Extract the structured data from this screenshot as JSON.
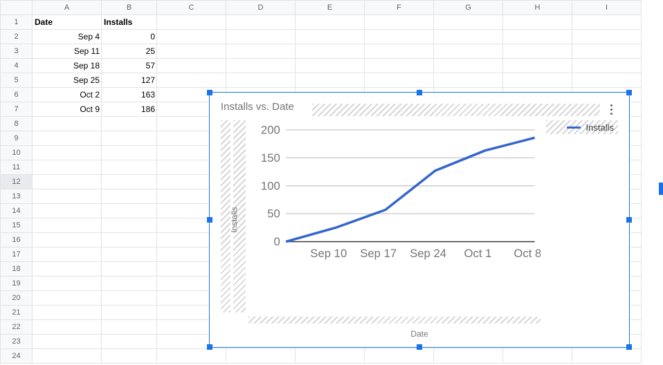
{
  "columns": [
    "A",
    "B",
    "C",
    "D",
    "E",
    "F",
    "G",
    "H",
    "I"
  ],
  "rows": 24,
  "header": {
    "A": "Date",
    "B": "Installs"
  },
  "data": [
    {
      "A": "Sep 4",
      "B": "0"
    },
    {
      "A": "Sep 11",
      "B": "25"
    },
    {
      "A": "Sep 18",
      "B": "57"
    },
    {
      "A": "Sep 25",
      "B": "127"
    },
    {
      "A": "Oct 2",
      "B": "163"
    },
    {
      "A": "Oct 9",
      "B": "186"
    }
  ],
  "selected_row": 12,
  "chart": {
    "title": "Installs vs. Date",
    "xlabel": "Date",
    "ylabel": "Installs",
    "legend": "Installs",
    "x_ticks": [
      "Sep 10",
      "Sep 17",
      "Sep 24",
      "Oct 1",
      "Oct 8"
    ],
    "y_ticks": [
      0,
      50,
      100,
      150,
      200
    ],
    "line_color": "#3366cc"
  },
  "chart_data": {
    "type": "line",
    "title": "Installs vs. Date",
    "xlabel": "Date",
    "ylabel": "Installs",
    "ylim": [
      0,
      200
    ],
    "series": [
      {
        "name": "Installs",
        "x": [
          "Sep 4",
          "Sep 11",
          "Sep 18",
          "Sep 25",
          "Oct 2",
          "Oct 9"
        ],
        "y": [
          0,
          25,
          57,
          127,
          163,
          186
        ]
      }
    ],
    "x_ticks": [
      "Sep 10",
      "Sep 17",
      "Sep 24",
      "Oct 1",
      "Oct 8"
    ]
  }
}
